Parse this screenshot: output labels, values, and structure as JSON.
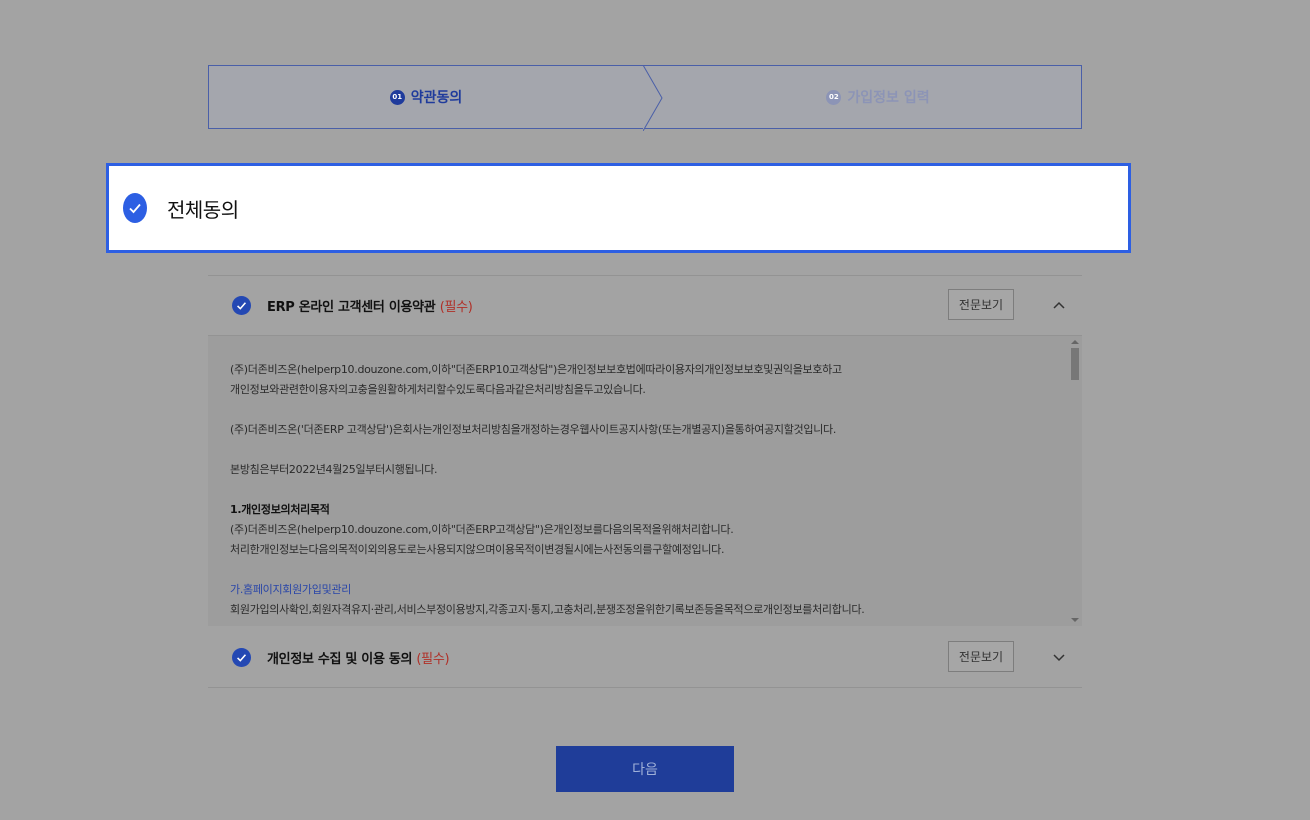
{
  "stepper": {
    "step1": {
      "num": "01",
      "label": "약관동의"
    },
    "step2": {
      "num": "02",
      "label": "가입정보 입력"
    }
  },
  "all_agree": {
    "label": "전체동의",
    "checked": true
  },
  "terms": [
    {
      "title": "ERP 온라인 고객센터 이용약관",
      "required": "(필수)",
      "view_label": "전문보기",
      "expanded": true,
      "checked": true
    },
    {
      "title": "개인정보 수집 및 이용 동의",
      "required": "(필수)",
      "view_label": "전문보기",
      "expanded": false,
      "checked": true
    }
  ],
  "terms_text": {
    "p1_line1": "(주)더존비즈온(helperp10.douzone.com,이하\"더존ERP10고객상담\")은개인정보보호법에따라이용자의개인정보보호및권익을보호하고",
    "p1_line2": "개인정보와관련한이용자의고충을원활하게처리할수있도록다음과같은처리방침을두고있습니다.",
    "p2": "(주)더존비즈온('더존ERP 고객상담')은회사는개인정보처리방침을개정하는경우웹사이트공지사항(또는개별공지)을통하여공지할것입니다.",
    "p3": "본방침은부터2022년4월25일부터시행됩니다.",
    "heading1": "1.개인정보의처리목적",
    "p4_line1": "(주)더존비즈온(helperp10.douzone.com,이하\"더존ERP고객상담\")은개인정보를다음의목적을위해처리합니다.",
    "p4_line2": "처리한개인정보는다음의목적이외의용도로는사용되지않으며이용목적이변경될시에는사전동의를구할예정입니다.",
    "sub1": "가.홈페이지회원가입및관리",
    "p5": "회원가입의사확인,회원자격유지·관리,서비스부정이용방지,각종고지·통지,고충처리,분쟁조정을위한기록보존등을목적으로개인정보를처리합니다."
  },
  "next_button": {
    "label": "다음"
  },
  "colors": {
    "accent": "#2d5fe3",
    "primary": "#1f3d99",
    "required": "#b03028"
  }
}
